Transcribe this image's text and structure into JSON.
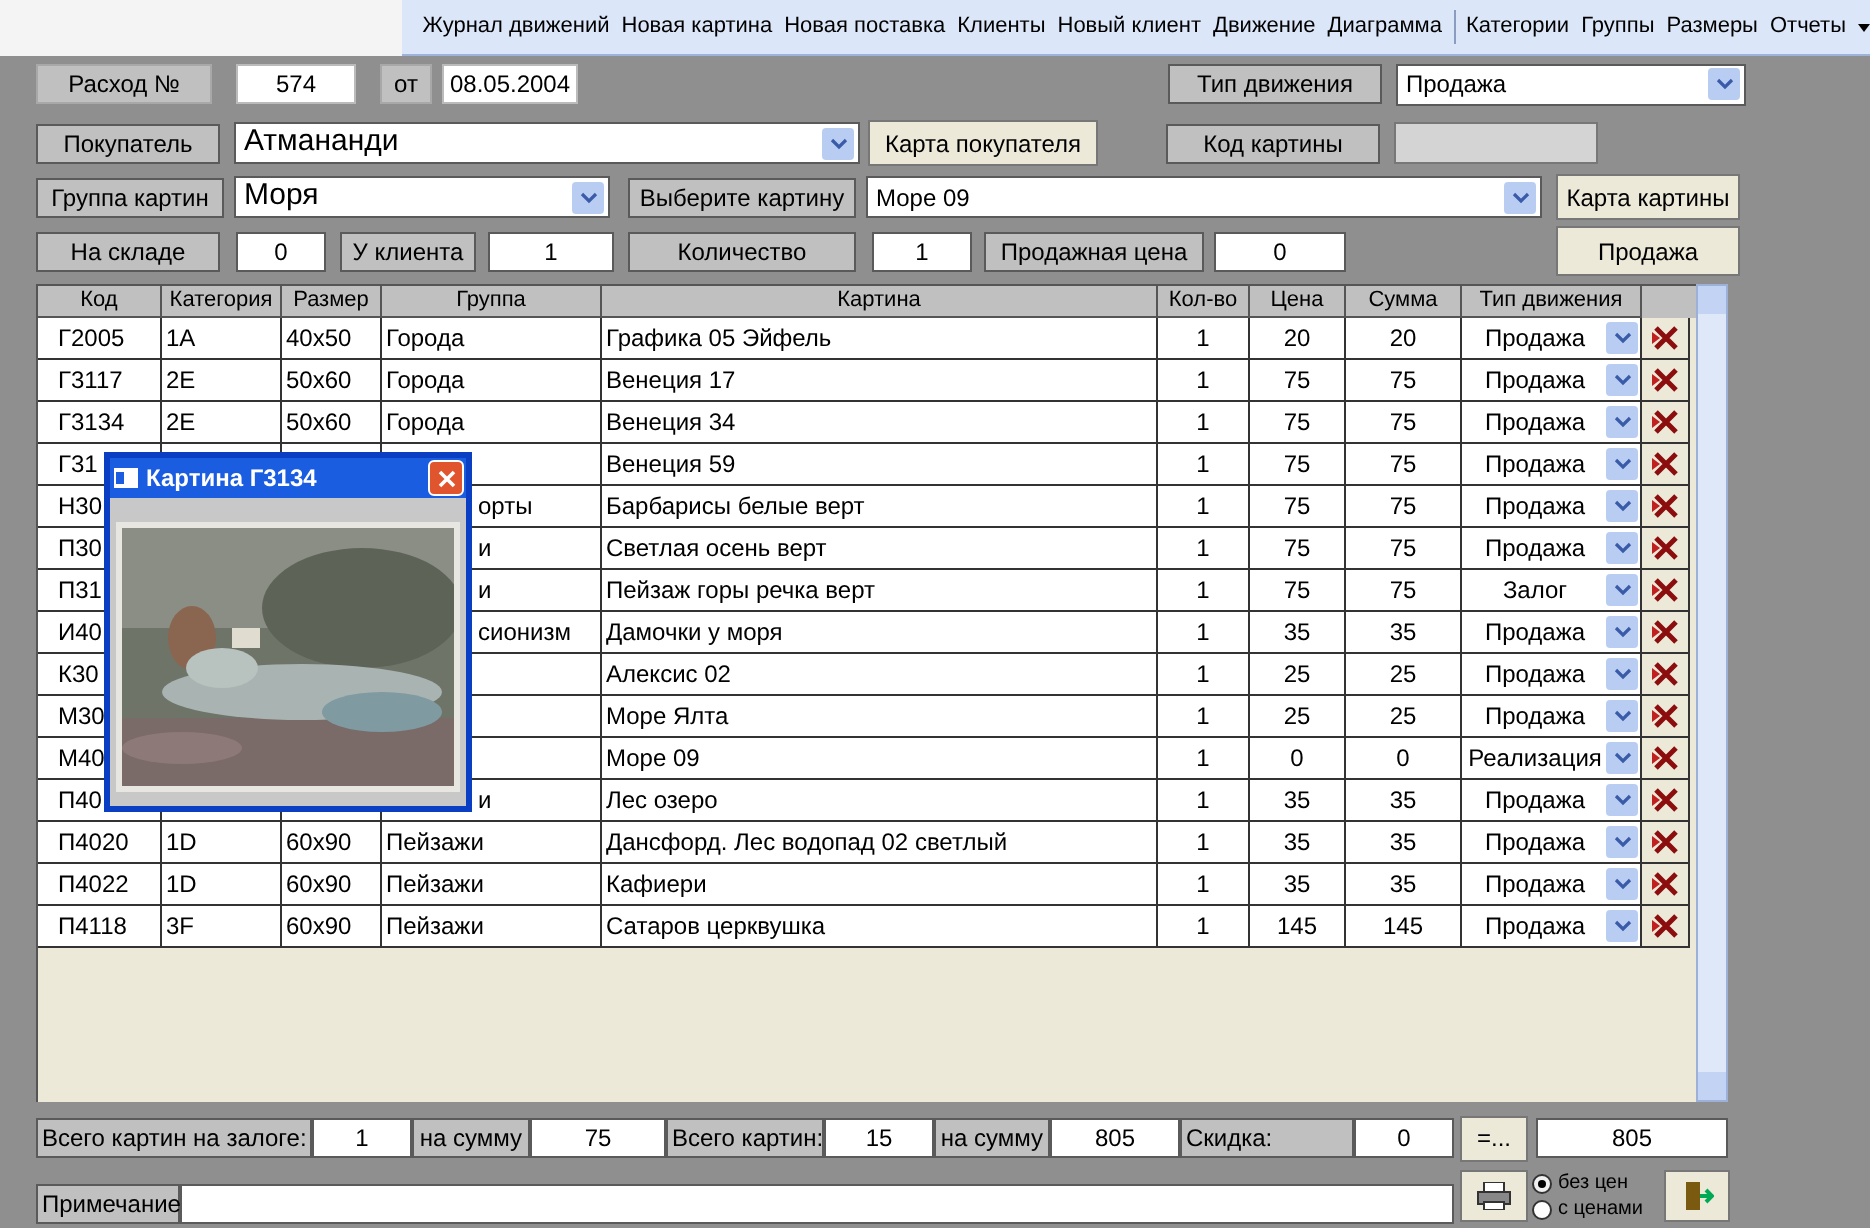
{
  "toolbar": {
    "items": [
      "Журнал движений",
      "Новая картина",
      "Новая поставка",
      "Клиенты",
      "Новый клиент",
      "Движение",
      "Диаграмма",
      "Категории",
      "Группы",
      "Размеры",
      "Отчеты"
    ]
  },
  "header": {
    "number_label": "Расход №",
    "number": "574",
    "date_label": "от",
    "date": "08.05.2004",
    "movement_label": "Тип движения",
    "movement": "Продажа",
    "buyer_label": "Покупатель",
    "buyer": "Атмананди",
    "buyer_card_button": "Карта покупателя",
    "code_label": "Код картины",
    "group_label": "Группа картин",
    "group": "Моря",
    "choose_label": "Выберите картину",
    "choose": "Море 09",
    "painting_card_button": "Карта картины",
    "stock_label": "На складе",
    "stock": "0",
    "client_label": "У клиента",
    "client": "1",
    "qty_label": "Количество",
    "qty": "1",
    "price_label": "Продажная цена",
    "price": "0",
    "sell_button": "Продажа"
  },
  "table": {
    "columns": [
      "Код",
      "Категория",
      "Размер",
      "Группа",
      "Картина",
      "Кол-во",
      "Цена",
      "Сумма",
      "Тип движения"
    ],
    "rows": [
      {
        "code": "Г2005",
        "category": "1A",
        "size": "40x50",
        "group": "Города",
        "painting": "Графика 05 Эйфель",
        "qty": "1",
        "price": "20",
        "sum": "20",
        "movement": "Продажа"
      },
      {
        "code": "Г3117",
        "category": "2E",
        "size": "50x60",
        "group": "Города",
        "painting": "Венеция 17",
        "qty": "1",
        "price": "75",
        "sum": "75",
        "movement": "Продажа"
      },
      {
        "code": "Г3134",
        "category": "2E",
        "size": "50x60",
        "group": "Города",
        "painting": "Венеция 34",
        "qty": "1",
        "price": "75",
        "sum": "75",
        "movement": "Продажа"
      },
      {
        "code": "Г31",
        "painting": "Венеция 59",
        "qty": "1",
        "price": "75",
        "sum": "75",
        "movement": "Продажа"
      },
      {
        "code": "Н30",
        "group": "орты",
        "painting": "Барбарисы белые верт",
        "qty": "1",
        "price": "75",
        "sum": "75",
        "movement": "Продажа"
      },
      {
        "code": "П30",
        "group": "и",
        "painting": "Светлая осень верт",
        "qty": "1",
        "price": "75",
        "sum": "75",
        "movement": "Продажа"
      },
      {
        "code": "П31",
        "group": "и",
        "painting": "Пейзаж горы речка верт",
        "qty": "1",
        "price": "75",
        "sum": "75",
        "movement": "Залог"
      },
      {
        "code": "И40",
        "group": "сионизм",
        "painting": "Дамочки у моря",
        "qty": "1",
        "price": "35",
        "sum": "35",
        "movement": "Продажа"
      },
      {
        "code": "К30",
        "painting": "Алексис 02",
        "qty": "1",
        "price": "25",
        "sum": "25",
        "movement": "Продажа"
      },
      {
        "code": "М30",
        "painting": "Море Ялта",
        "qty": "1",
        "price": "25",
        "sum": "25",
        "movement": "Продажа"
      },
      {
        "code": "М40",
        "painting": "Море 09",
        "qty": "1",
        "price": "0",
        "sum": "0",
        "movement": "Реализация"
      },
      {
        "code": "П40",
        "group": "и",
        "painting": "Лес озеро",
        "qty": "1",
        "price": "35",
        "sum": "35",
        "movement": "Продажа"
      },
      {
        "code": "П4020",
        "category": "1D",
        "size": "60x90",
        "group": "Пейзажи",
        "painting": "Дансфорд. Лес водопад 02 светлый",
        "qty": "1",
        "price": "35",
        "sum": "35",
        "movement": "Продажа"
      },
      {
        "code": "П4022",
        "category": "1D",
        "size": "60x90",
        "group": "Пейзажи",
        "painting": "Кафиери",
        "qty": "1",
        "price": "35",
        "sum": "35",
        "movement": "Продажа"
      },
      {
        "code": "П4118",
        "category": "3F",
        "size": "60x90",
        "group": "Пейзажи",
        "painting": "Сатаров церквушка",
        "qty": "1",
        "price": "145",
        "sum": "145",
        "movement": "Продажа"
      }
    ]
  },
  "popup": {
    "title": "Картина Г3134"
  },
  "totals": {
    "pledge_label": "Всего картин на залоге:",
    "pledge": "1",
    "pledge_sum_label": "на сумму",
    "pledge_sum": "75",
    "total_label": "Всего картин:",
    "total": "15",
    "total_sum_label": "на сумму",
    "total_sum": "805",
    "discount_label": "Скидка:",
    "discount": "0",
    "calc_button": "=...",
    "result": "805"
  },
  "footer": {
    "note_label": "Примечание",
    "radios": [
      {
        "label": "без цен",
        "selected": true
      },
      {
        "label": "с ценами",
        "selected": false
      }
    ]
  }
}
